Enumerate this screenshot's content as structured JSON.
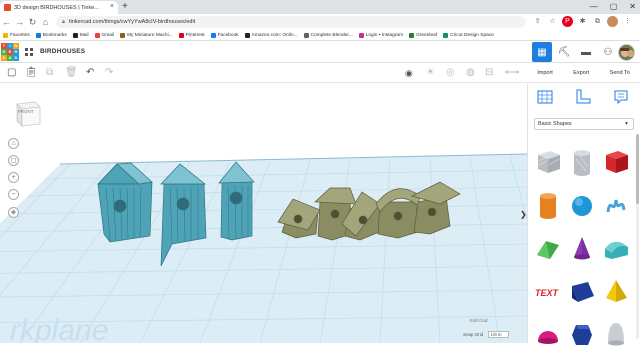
{
  "browser": {
    "tab_title": "3D design BIRDHOUSES | Tinke...",
    "tab_close": "×",
    "new_tab": "+",
    "window_controls": [
      "—",
      "▢",
      "✕"
    ],
    "url": "tinkercad.com/things/cwYyYwA8cIV-birdhouses/edit",
    "bookmarks": [
      {
        "label": "Favorites",
        "color": "#f4b400"
      },
      {
        "label": "Bookmarks",
        "color": "#1a73e8"
      },
      {
        "label": "Mail",
        "color": "#222222"
      },
      {
        "label": "Gmail",
        "color": "#ea4335"
      },
      {
        "label": "My Miniature Machi...",
        "color": "#8d5a2b"
      },
      {
        "label": "Pinterest",
        "color": "#e60023"
      },
      {
        "label": "Facebook",
        "color": "#1877f2"
      },
      {
        "label": "Amazon.com: Onlin...",
        "color": "#222222"
      },
      {
        "label": "Complete Blender...",
        "color": "#5f6368"
      },
      {
        "label": "Login • Instagram",
        "color": "#c13584"
      },
      {
        "label": "Greenleaf",
        "color": "#2e7d32"
      },
      {
        "label": "Cricut Design Space",
        "color": "#1b8f5a"
      }
    ]
  },
  "app": {
    "logo_letters": [
      "TIN",
      "KER",
      "CAD"
    ],
    "logo_colors": [
      "#e34d2e",
      "#1f9de0",
      "#f0a61c",
      "#49b24f",
      "#e34d2e",
      "#1f9de0",
      "#f0a61c",
      "#49b24f",
      "#1f9de0"
    ],
    "design_title": "BIRDHOUSES"
  },
  "panel": {
    "import_label": "Import",
    "export_label": "Export",
    "sendto_label": "Send To",
    "shapes_category": "Basic Shapes"
  },
  "workplane": {
    "viewcube_label": "FRONT",
    "edit_grid_label": "Edit Grid",
    "snap_grid_label": "Snap Grid",
    "snap_grid_value": "1/8 in",
    "watermark": "rkplane",
    "zoom_in": "+",
    "zoom_out": "−",
    "collapse_arrow": "❯"
  },
  "shapes": [
    {
      "name": "box-hole",
      "color": "#b9bec4"
    },
    {
      "name": "cylinder-hole",
      "color": "#b9bec4"
    },
    {
      "name": "box",
      "color": "#d7262b"
    },
    {
      "name": "cylinder",
      "color": "#e4821f"
    },
    {
      "name": "sphere",
      "color": "#1d97d6"
    },
    {
      "name": "scribble",
      "color": "#4ea2db"
    },
    {
      "name": "roof",
      "color": "#3daa45"
    },
    {
      "name": "cone",
      "color": "#8f3ab7"
    },
    {
      "name": "round-roof",
      "color": "#36b0b4"
    },
    {
      "name": "text",
      "color": "#d7262b"
    },
    {
      "name": "wedge",
      "color": "#1e3e9a"
    },
    {
      "name": "pyramid",
      "color": "#f2c80f"
    },
    {
      "name": "half-sphere",
      "color": "#d91c85"
    },
    {
      "name": "polygon",
      "color": "#1e3e9a"
    },
    {
      "name": "paraboloid",
      "color": "#c9ccd1"
    }
  ],
  "colors": {
    "accent": "#1f7de0",
    "birdhouse_teal": "#4ea3b6",
    "birdhouse_olive": "#8a8c62",
    "grid_blue": "#bcd9ea"
  }
}
